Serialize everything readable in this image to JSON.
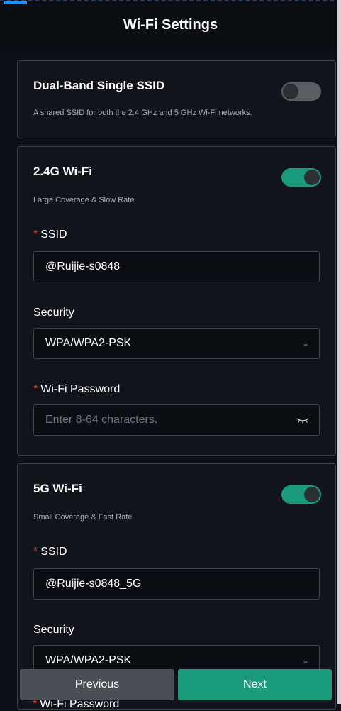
{
  "header": {
    "title": "Wi-Fi Settings"
  },
  "dual_band": {
    "title": "Dual-Band Single SSID",
    "description": "A shared SSID for both the 2.4 GHz and 5 GHz Wi-Fi networks.",
    "enabled": false
  },
  "band_24": {
    "title": "2.4G Wi-Fi",
    "description": "Large Coverage & Slow Rate",
    "enabled": true,
    "ssid_label": "SSID",
    "ssid_value": "@Ruijie-s0848",
    "security_label": "Security",
    "security_value": "WPA/WPA2-PSK",
    "password_label": "Wi-Fi Password",
    "password_placeholder": "Enter 8-64 characters."
  },
  "band_5": {
    "title": "5G Wi-Fi",
    "description": "Small Coverage & Fast Rate",
    "enabled": true,
    "ssid_label": "SSID",
    "ssid_value": "@Ruijie-s0848_5G",
    "security_label": "Security",
    "security_value": "WPA/WPA2-PSK",
    "password_label": "Wi-Fi Password"
  },
  "required_mark": "*",
  "footer": {
    "previous_label": "Previous",
    "next_label": "Next"
  },
  "colors": {
    "accent": "#1a9b7c",
    "required": "#e0443c",
    "background": "#0d1117"
  }
}
